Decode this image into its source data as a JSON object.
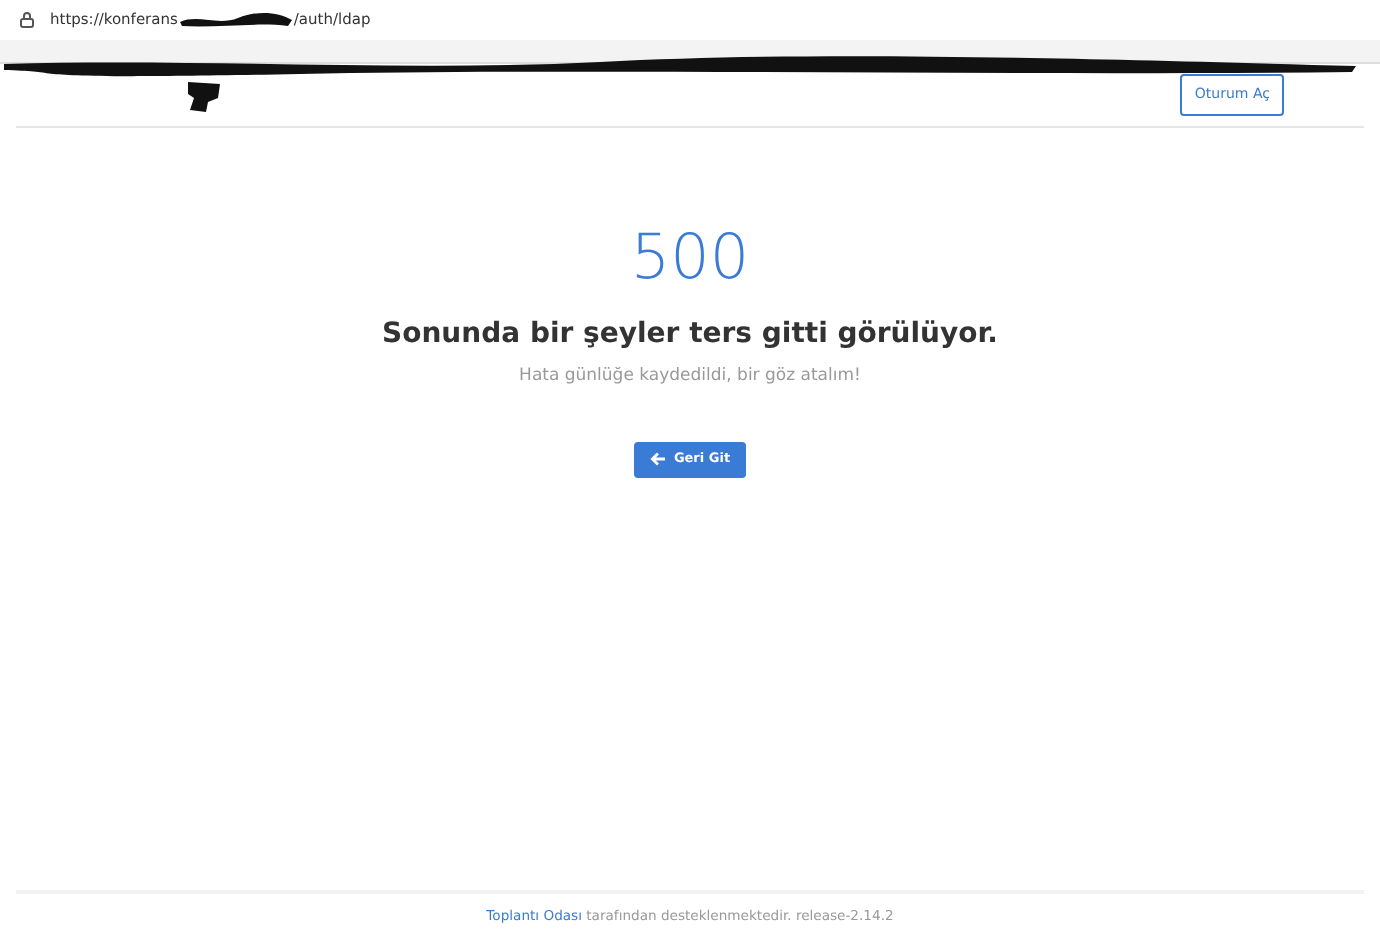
{
  "browser": {
    "url_start": "https://konferans",
    "url_end": "/auth/ldap"
  },
  "navbar": {
    "login_button": "Oturum Aç"
  },
  "error": {
    "code": "500",
    "title": "Sonunda bir şeyler ters gitti görülüyor.",
    "subtitle": "Hata günlüğe kaydedildi, bir göz atalım!",
    "back_button": "Geri Git"
  },
  "footer": {
    "link": "Toplantı Odası",
    "text": " tarafından desteklenmektedir. release-2.14.2"
  }
}
